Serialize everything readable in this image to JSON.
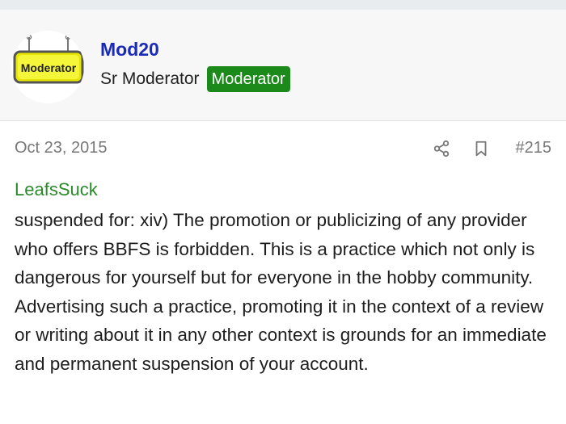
{
  "user": {
    "avatar_text": "Moderator",
    "name": "Mod20",
    "title": "Sr Moderator",
    "badge": "Moderator"
  },
  "post": {
    "date": "Oct 23, 2015",
    "number": "#215",
    "quote_author": "LeafsSuck",
    "body": "suspended for: xiv) The promotion or publicizing of any provider who offers BBFS is forbidden. This is a practice which not only is dangerous for yourself but for everyone in the hobby community. Advertising such a practice, promoting it in the context of a review or writing about it in any other context is grounds for an immediate and permanent suspension of your account."
  },
  "icons": {
    "share": "share-icon",
    "bookmark": "bookmark-icon"
  },
  "colors": {
    "username": "#1a2bb8",
    "badge_bg": "#1b8a1b",
    "quote_author": "#2a8a2a",
    "header_bg": "#f7f7f7"
  }
}
